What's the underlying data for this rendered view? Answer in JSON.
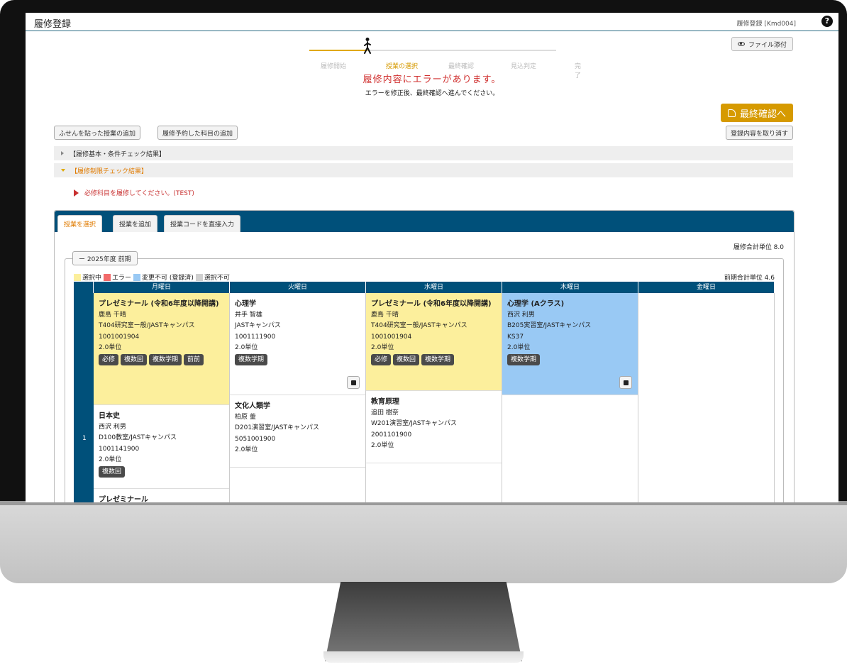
{
  "header": {
    "title": "履修登録",
    "screen_code": "履修登録 [Kmd004]"
  },
  "stepper": {
    "steps": [
      "履修開始",
      "授業の選択",
      "最終確認",
      "見込判定",
      "完了"
    ],
    "active_index": 1
  },
  "file_attach_label": "ファイル添付",
  "error": {
    "title": "履修内容にエラーがあります。",
    "subtitle": "エラーを修正後、最終確認へ進んでください。"
  },
  "final_confirm_label": "最終確認へ",
  "buttons": {
    "add_sticky": "ふせんを貼った授業の追加",
    "add_reserved": "履修予約した科目の追加",
    "cancel_registration": "登録内容を取り消す"
  },
  "accordions": [
    {
      "label": "【履修基本・条件チェック結果】",
      "open": false
    },
    {
      "label": "【履修制限チェック結果】",
      "open": true
    }
  ],
  "check_message": "必修科目を履修してください。(TEST)",
  "tabs": [
    "授業を選択",
    "授業を追加",
    "授業コードを直接入力"
  ],
  "active_tab": 0,
  "total_units_label": "履修合計単位 8.0",
  "term": {
    "toggle_label": "ー 2025年度 前期",
    "period_units_label": "前期合計単位 4.6",
    "legend": [
      {
        "label": "選択中",
        "color": "#fcef9c"
      },
      {
        "label": "エラー",
        "color": "#f26a6a"
      },
      {
        "label": "変更不可 (登録済)",
        "color": "#99c9f4"
      },
      {
        "label": "選択不可",
        "color": "#cfcfcf"
      }
    ],
    "days": [
      "月曜日",
      "火曜日",
      "水曜日",
      "木曜日",
      "金曜日"
    ],
    "period_label": "1",
    "monday": [
      {
        "title": "プレゼミナール (令和6年度以降開講)",
        "teacher": "鹿島 千晴",
        "room": "T404研究室ー般/JASTキャンパス",
        "code": "1001001904",
        "units": "2.0単位",
        "tags": [
          "必修",
          "複数回",
          "複数学期",
          "前前"
        ]
      },
      {
        "title": "日本史",
        "teacher": "西沢 利男",
        "room": "D100教室/JASTキャンパス",
        "code": "1001141900",
        "units": "2.0単位",
        "tags": [
          "複数回"
        ]
      },
      {
        "title": "プレゼミナール"
      }
    ],
    "tuesday": [
      {
        "title": "心理学",
        "teacher": "井手 智雄",
        "room": "JASTキャンパス",
        "code": "1001111900",
        "units": "2.0単位",
        "tags": [
          "複数学期"
        ]
      },
      {
        "title": "文化人類学",
        "teacher": "柏原 董",
        "room": "D201演習室/JASTキャンパス",
        "code": "5051001900",
        "units": "2.0単位"
      }
    ],
    "wednesday": [
      {
        "title": "プレゼミナール (令和6年度以降開講)",
        "teacher": "鹿島 千晴",
        "room": "T404研究室ー般/JASTキャンパス",
        "code": "1001001904",
        "units": "2.0単位",
        "tags": [
          "必修",
          "複数回",
          "複数学期"
        ]
      },
      {
        "title": "教育原理",
        "teacher": "追田 樹奈",
        "room": "W201演習室/JASTキャンパス",
        "code": "2001101900",
        "units": "2.0単位"
      }
    ],
    "thursday": [
      {
        "title": "心理学 (Aクラス)",
        "teacher": "西沢 利男",
        "room": "B205実習室/JASTキャンパス",
        "code": "KS37",
        "units": "2.0単位",
        "tags": [
          "複数学期"
        ]
      }
    ]
  }
}
